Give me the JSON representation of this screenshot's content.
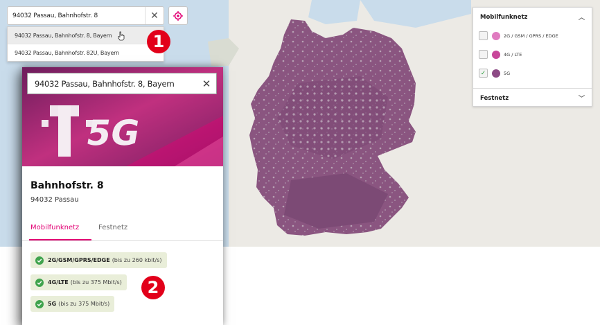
{
  "search": {
    "value": "94032 Passau, Bahnhofstr. 8",
    "clear_icon": "close-icon",
    "locate_icon": "crosshair-icon"
  },
  "suggestions": [
    "94032 Passau, Bahnhofstr. 8, Bayern",
    "94032 Passau, Bahnhofstr. 82U, Bayern"
  ],
  "callouts": {
    "one": "1",
    "two": "2"
  },
  "legend": {
    "mobile_title": "Mobilfunknetz",
    "layers": [
      {
        "label": "2G / GSM / GPRS / EDGE",
        "color": "#e07bc0",
        "checked": false
      },
      {
        "label": "4G / LTE",
        "color": "#c8479a",
        "checked": false
      },
      {
        "label": "5G",
        "color": "#8d4a85",
        "checked": true
      }
    ],
    "fixed_title": "Festnetz"
  },
  "panel": {
    "search_value": "94032 Passau, Bahnhofstr. 8, Bayern",
    "title": "Bahnhofstr. 8",
    "subtitle": "94032 Passau",
    "tabs": [
      "Mobilfunknetz",
      "Festnetz"
    ],
    "active_tab": "Mobilfunknetz",
    "services": [
      {
        "name": "2G/GSM/GPRS/EDGE",
        "rate": "(bis zu 260 kbit/s)"
      },
      {
        "name": "4G/LTE",
        "rate": "(bis zu 375 Mbit/s)"
      },
      {
        "name": "5G",
        "rate": "(bis zu 375 Mbit/s)"
      }
    ],
    "hero_text": "T 5G"
  },
  "colors": {
    "brand": "#e20074",
    "coverage": "#8a5580",
    "callout": "#e2001a",
    "check": "#3fa34d"
  }
}
